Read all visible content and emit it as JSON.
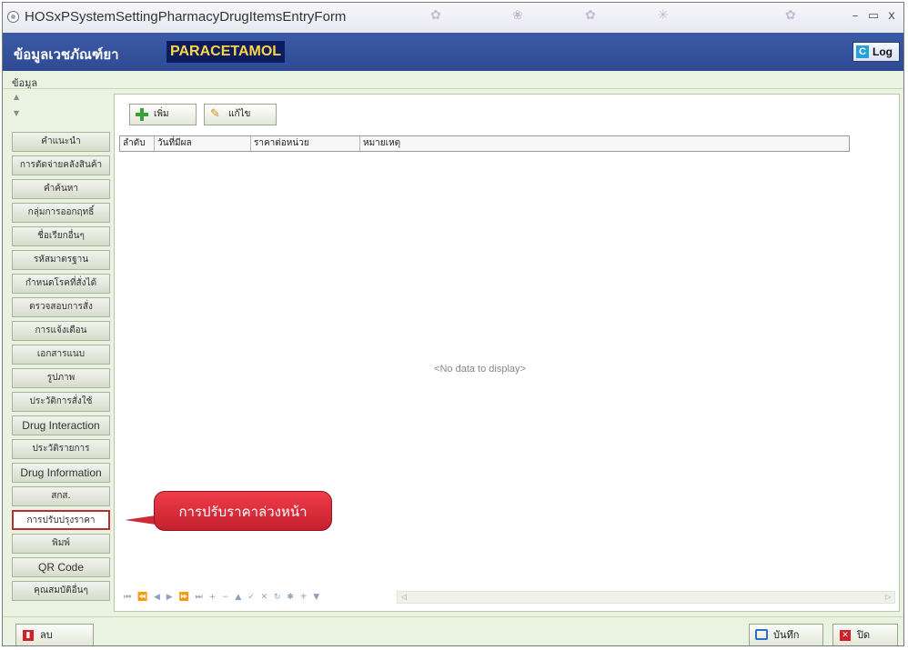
{
  "window": {
    "title": "HOSxPSystemSettingPharmacyDrugItemsEntryForm",
    "minimize": "–",
    "maximize": "▭",
    "close": "x"
  },
  "header": {
    "title": "ข้อมูลเวชภัณฑ์ยา",
    "drug_name": "PARACETAMOL",
    "log_label": "Log"
  },
  "section": {
    "label": "ข้อมูล"
  },
  "nav": {
    "up": "▲",
    "down": "▼",
    "items": [
      "คำแนะนำ",
      "การตัดจ่ายคลังสินค้า",
      "คำค้นหา",
      "กลุ่มการออกฤทธิ์",
      "ชื่อเรียกอื่นๆ",
      "รหัสมาตรฐาน",
      "กำหนดโรคที่สั่งได้",
      "ตรวจสอบการสั่ง",
      "การแจ้งเตือน",
      "เอกสารแนบ",
      "รูปภาพ",
      "ประวัติการสั่งใช้",
      "Drug Interaction",
      "ประวัติรายการ",
      "Drug Information",
      "สกส.",
      "การปรับปรุงราคา",
      "พิมพ์",
      "QR Code",
      "คุณสมบัติอื่นๆ"
    ],
    "selected_index": 16
  },
  "toolbar": {
    "add_label": "เพิ่ม",
    "edit_label": "แก้ไข"
  },
  "grid": {
    "columns": [
      "ลำดับ",
      "วันที่มีผล",
      "ราคาต่อหน่วย",
      "หมายเหตุ"
    ],
    "empty_text": "<No data to display>",
    "navigator": "⏮ ⏪ ◀ ▶ ⏩ ⏭ + − ▲ ✓ ✕ ↻ ✱ ✳ ▼"
  },
  "callout": {
    "text": "การปรับราคาล่วงหน้า"
  },
  "footer": {
    "delete_label": "ลบ",
    "save_label": "บันทึก",
    "close_label": "ปิด"
  },
  "colors": {
    "header_bg": "#3552a0",
    "drug_name_bg": "#0b1d5c",
    "drug_name_fg": "#ffd64a",
    "callout": "#e3303e",
    "selected_border": "#b23030"
  }
}
